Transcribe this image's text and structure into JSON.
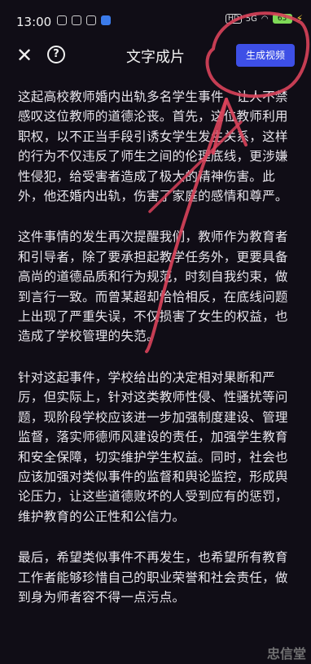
{
  "status_bar": {
    "time": "13:00",
    "network_label": "HD",
    "signal_label": "5G",
    "battery_label": "63"
  },
  "topbar": {
    "close_icon": "close-icon",
    "help_icon": "help-icon",
    "title": "文字成片",
    "generate_button": "生成视频"
  },
  "article": {
    "paragraphs": [
      "这起高校教师婚内出轨多名学生事件，让人不禁感叹这位教师的道德沦丧。首先，这位教师利用职权，以不正当手段引诱女学生发生关系，这样的行为不仅违反了师生之间的伦理底线，更涉嫌性侵犯，给受害者造成了极大的精神伤害。此外，他还婚内出轨，伤害了家庭的感情和尊严。",
      "这件事情的发生再次提醒我们，教师作为教育者和引导者，除了要承担起教学任务外，更要具备高尚的道德品质和行为规范，时刻自我约束，做到言行一致。而曾某超却恰恰相反，在底线问题上出现了严重失误，不仅损害了女生的权益，也造成了学校管理的失范。",
      "针对这起事件，学校给出的决定相对果断和严厉，但实际上，针对这类教师性侵、性骚扰等问题，现阶段学校应该进一步加强制度建设、管理监督，落实师德师风建设的责任，加强学生教育和安全保障，切实维护学生权益。同时，社会也应该加强对类似事件的监督和舆论监控，形成舆论压力，让这些道德败坏的人受到应有的惩罚，维护教育的公正性和公信力。",
      "最后，希望类似事件不再发生，也希望所有教育工作者能够珍惜自己的职业荣誉和社会责任，做到身为师者容不得一点污点。"
    ]
  },
  "watermark": "忠信堂",
  "colors": {
    "background": "#100d16",
    "button": "#3d4fe6",
    "annotation": "#d9425a"
  }
}
